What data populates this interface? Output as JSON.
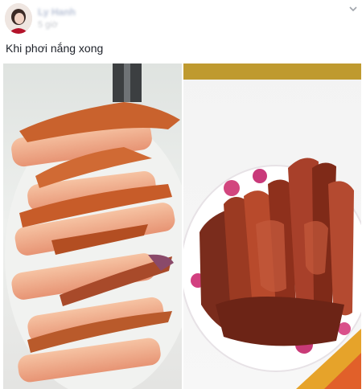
{
  "post": {
    "author_name": "Ly Hanh",
    "timestamp": "5 giờ",
    "text": "Khi phơi nắng xong",
    "menu_icon": "chevron-down-icon",
    "photos": [
      {
        "description": "drying-pork-strips-on-plate"
      },
      {
        "description": "dried-pork-on-flower-plate"
      }
    ]
  }
}
